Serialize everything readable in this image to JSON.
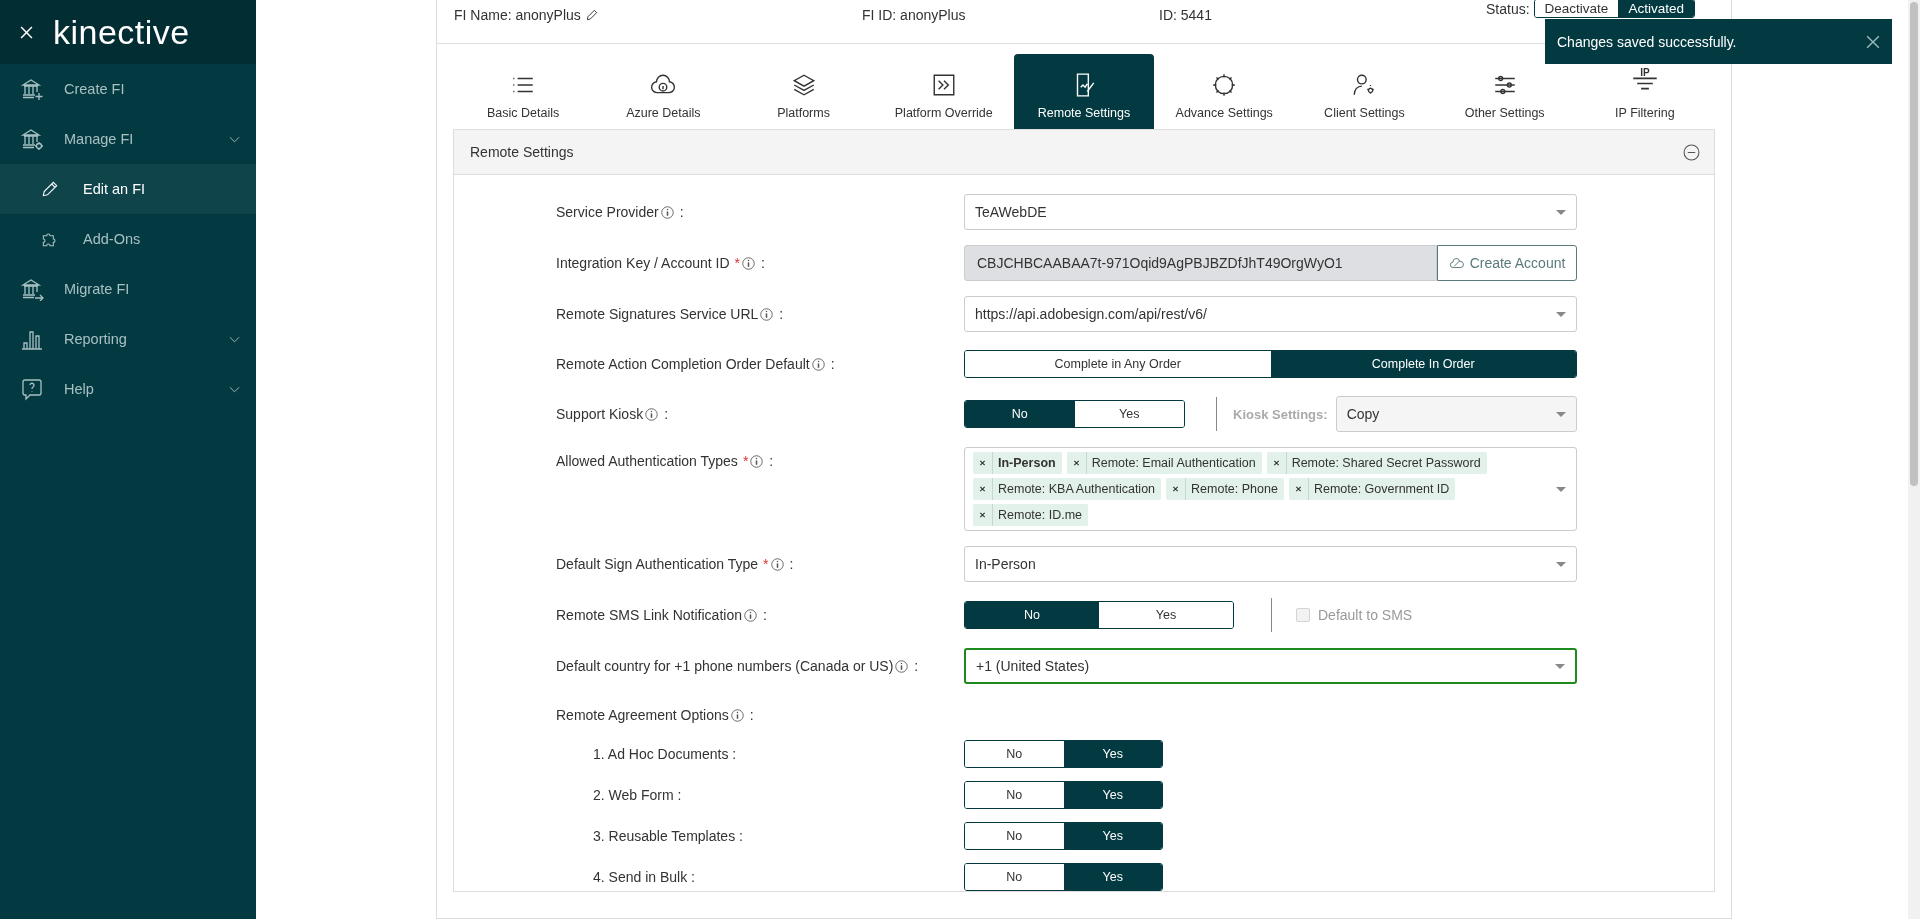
{
  "sidebar": {
    "logo": "kinective",
    "items": [
      {
        "label": "Create FI",
        "kind": "link",
        "selected": false
      },
      {
        "label": "Manage FI",
        "kind": "group",
        "selected": false,
        "children": [
          {
            "label": "Edit an FI",
            "selected": true
          },
          {
            "label": "Add-Ons",
            "selected": false
          }
        ]
      },
      {
        "label": "Migrate FI",
        "kind": "link",
        "selected": false
      },
      {
        "label": "Reporting",
        "kind": "group",
        "selected": false
      },
      {
        "label": "Help",
        "kind": "group",
        "selected": false
      }
    ]
  },
  "header": {
    "fi_name": "FI Name: anonyPlus",
    "fi_id": "FI ID: anonyPlus",
    "id": "ID: 5441",
    "status_label": "Status:",
    "status_options": [
      {
        "label": "Deactivate",
        "selected": false
      },
      {
        "label": "Activated",
        "selected": true
      }
    ]
  },
  "toast": {
    "message": "Changes saved successfully."
  },
  "tabs": [
    {
      "label": "Basic Details",
      "selected": false
    },
    {
      "label": "Azure Details",
      "selected": false
    },
    {
      "label": "Platforms",
      "selected": false
    },
    {
      "label": "Platform Override",
      "selected": false
    },
    {
      "label": "Remote Settings",
      "selected": true
    },
    {
      "label": "Advance Settings",
      "selected": false
    },
    {
      "label": "Client Settings",
      "selected": false
    },
    {
      "label": "Other Settings",
      "selected": false
    },
    {
      "label": "IP Filtering",
      "icon_text": "IP",
      "selected": false
    }
  ],
  "section": {
    "title": "Remote Settings",
    "expanded": true,
    "fields": [
      {
        "kind": "select",
        "label": "Service Provider",
        "info": true,
        "suffix": ":",
        "value": "TeAWebDE"
      },
      {
        "kind": "input_button",
        "label": "Integration Key / Account ID",
        "required_mark": "*",
        "info": true,
        "suffix": ":",
        "value": "CBJCHBCAABAA7t-971Oqid9AgPBJBZDfJhT49OrgWyO1",
        "button": "Create Account"
      },
      {
        "kind": "select",
        "label": "Remote Signatures Service URL",
        "info": true,
        "suffix": ":",
        "value": "https://api.adobesign.com/api/rest/v6/"
      },
      {
        "kind": "segmented",
        "label": "Remote Action Completion Order Default",
        "info": true,
        "suffix": ":",
        "options": [
          {
            "label": "Complete in Any Order",
            "selected": false
          },
          {
            "label": "Complete In Order",
            "selected": true
          }
        ]
      },
      {
        "kind": "toggle_select",
        "label": "Support Kiosk",
        "info": true,
        "suffix": ":",
        "options": [
          {
            "label": "No",
            "selected": true
          },
          {
            "label": "Yes",
            "selected": false
          }
        ],
        "extra_label": "Kiosk Settings:",
        "extra_value": "Copy",
        "extra_disabled": true
      },
      {
        "kind": "tags",
        "label": "Allowed Authentication Types",
        "required_mark": "*",
        "info": true,
        "suffix": ":",
        "tags": [
          {
            "label": "In-Person",
            "default": true
          },
          {
            "label": "Remote: Email Authentication",
            "default": false
          },
          {
            "label": "Remote: Shared Secret Password",
            "default": false
          },
          {
            "label": "Remote: KBA Authentication",
            "default": false
          },
          {
            "label": "Remote: Phone",
            "default": false
          },
          {
            "label": "Remote: Government ID",
            "default": false
          },
          {
            "label": "Remote: ID.me",
            "default": false
          }
        ]
      },
      {
        "kind": "select",
        "label": "Default Sign Authentication Type",
        "required_mark": "*",
        "info": true,
        "suffix": ":",
        "value": "In-Person"
      },
      {
        "kind": "toggle_check",
        "label": "Remote SMS Link Notification",
        "info": true,
        "suffix": ":",
        "options": [
          {
            "label": "No",
            "selected": true
          },
          {
            "label": "Yes",
            "selected": false
          }
        ],
        "check_label": "Default to SMS",
        "checked": false,
        "check_disabled": true
      },
      {
        "kind": "select",
        "label": "Default country for +1 phone numbers (Canada or US)",
        "info": true,
        "suffix": ":",
        "value": "+1 (United States)",
        "focused": true
      },
      {
        "kind": "heading",
        "label": "Remote Agreement Options",
        "info": true,
        "suffix": ":"
      },
      {
        "kind": "suboption",
        "label": "1. Ad Hoc Documents :",
        "options": [
          {
            "label": "No",
            "selected": false
          },
          {
            "label": "Yes",
            "selected": true
          }
        ]
      },
      {
        "kind": "suboption",
        "label": "2. Web Form :",
        "options": [
          {
            "label": "No",
            "selected": false
          },
          {
            "label": "Yes",
            "selected": true
          }
        ]
      },
      {
        "kind": "suboption",
        "label": "3. Reusable Templates :",
        "options": [
          {
            "label": "No",
            "selected": false
          },
          {
            "label": "Yes",
            "selected": true
          }
        ]
      },
      {
        "kind": "suboption",
        "label": "4. Send in Bulk :",
        "options": [
          {
            "label": "No",
            "selected": false
          },
          {
            "label": "Yes",
            "selected": true
          }
        ]
      }
    ]
  }
}
